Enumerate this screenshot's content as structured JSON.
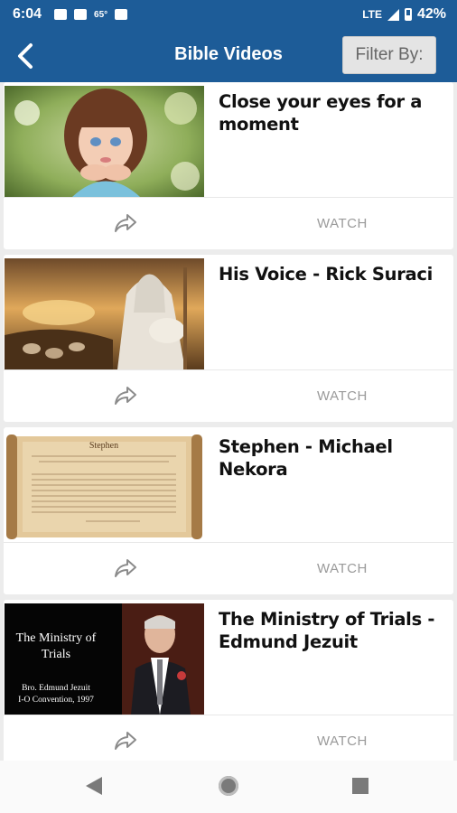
{
  "status_bar": {
    "time": "6:04",
    "temperature": "65°",
    "network": "LTE",
    "battery": "42%"
  },
  "app_bar": {
    "title": "Bible Videos",
    "filter_label": "Filter By:",
    "accent_color": "#1d5c98"
  },
  "videos": [
    {
      "title": "Close your eyes for a moment",
      "thumbnail": "child-portrait-image",
      "share_icon": "share-arrow-icon",
      "action": "WATCH"
    },
    {
      "title": "His Voice - Rick Suraci",
      "thumbnail": "shepherd-painting-image",
      "share_icon": "share-arrow-icon",
      "action": "WATCH"
    },
    {
      "title": "Stephen - Michael Nekora",
      "thumbnail": "scroll-image",
      "thumbnail_text": [
        "Stephen"
      ],
      "share_icon": "share-arrow-icon",
      "action": "WATCH"
    },
    {
      "title": "The Ministry of Trials  - Edmund Jezuit",
      "thumbnail": "ministry-title-card-image",
      "thumbnail_text": [
        "The Ministry of",
        "Trials",
        "Bro. Edmund Jezuit",
        "I-O Convention, 1997"
      ],
      "share_icon": "share-arrow-icon",
      "action": "WATCH"
    }
  ],
  "nav_bar": {
    "buttons": [
      "back-triangle-icon",
      "home-circle-icon",
      "recents-square-icon"
    ]
  }
}
